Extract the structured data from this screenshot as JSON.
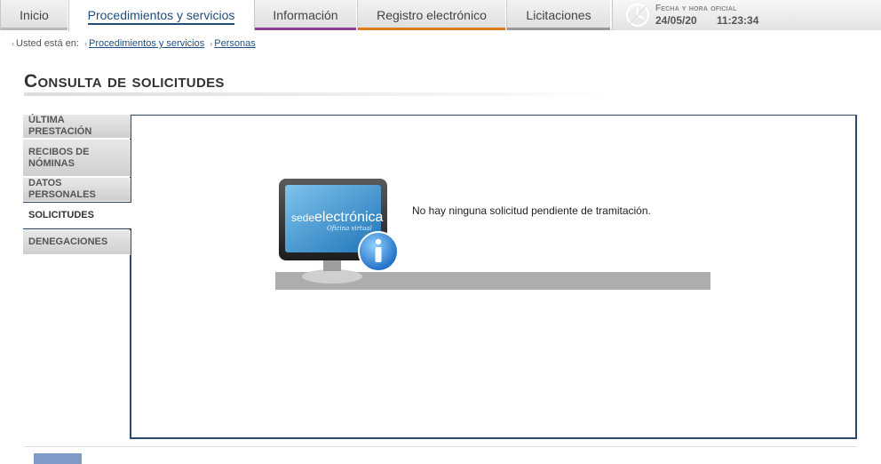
{
  "nav": {
    "tabs": [
      {
        "label": "Inicio",
        "color": "#b9b9b9"
      },
      {
        "label": "Procedimientos y servicios",
        "color": "#ffffff"
      },
      {
        "label": "Información",
        "color": "#8e3f96"
      },
      {
        "label": "Registro electrónico",
        "color": "#e07a1f"
      },
      {
        "label": "Licitaciones",
        "color": "#9a9a9a"
      }
    ],
    "active_index": 1
  },
  "clock": {
    "title": "Fecha y hora oficial",
    "date": "24/05/20",
    "time": "11:23:34"
  },
  "breadcrumb": {
    "prefix": "Usted está en:",
    "items": [
      "Procedimientos y servicios",
      "Personas"
    ]
  },
  "page": {
    "title": "Consulta de solicitudes"
  },
  "submenu": {
    "items": [
      {
        "label": "ÚLTIMA PRESTACIÓN"
      },
      {
        "label": "RECIBOS DE NÓMINAS"
      },
      {
        "label": "DATOS PERSONALES"
      },
      {
        "label": "SOLICITUDES"
      },
      {
        "label": "DENEGACIONES"
      }
    ],
    "active_index": 3
  },
  "content": {
    "message": "No hay ninguna solicitud pendiente de tramitación.",
    "logo_text_main": "sede",
    "logo_text_accent": "electrónica",
    "logo_subtext": "Oficina virtual"
  },
  "colors": {
    "brand_blue": "#214d7c",
    "panel_border": "#2a4a72"
  }
}
